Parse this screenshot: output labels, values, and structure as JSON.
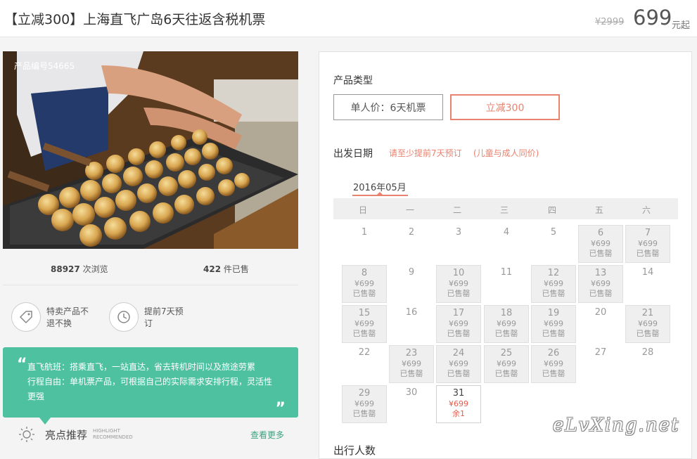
{
  "header": {
    "title": "【立减300】上海直飞广岛6天往返含税机票",
    "original_price": "¥2999",
    "price": "699",
    "price_suffix": "元起"
  },
  "product": {
    "id_label": "产品编号54665",
    "views_count": "88927",
    "views_label": "次浏览",
    "sold_count": "422",
    "sold_label": "件已售"
  },
  "features": [
    {
      "icon": "tag-icon",
      "text": "特卖产品不退不换"
    },
    {
      "icon": "clock-icon",
      "text": "提前7天预订"
    }
  ],
  "highlights": {
    "lines": [
      "直飞航班：搭乘直飞，一站直达，省去转机时间以及旅途劳累",
      "行程自由：单机票产品，可根据自己的实际需求安排行程，灵活性更强"
    ],
    "title": "亮点推荐",
    "title_en_1": "HIGHLIGHT",
    "title_en_2": "RECOMMENDED",
    "more": "查看更多"
  },
  "booking": {
    "type_label": "产品类型",
    "types": [
      "单人价：6天机票",
      "立减300"
    ],
    "selected_type": "立减300",
    "date_label": "出发日期",
    "note1": "请至少提前7天预订",
    "note2": "(儿童与成人同价)",
    "month": "2016年05月",
    "weekdays": [
      "日",
      "一",
      "二",
      "三",
      "四",
      "五",
      "六"
    ],
    "travelers_label": "出行人数"
  },
  "calendar": {
    "start_weekday": 0,
    "days": [
      {
        "d": "1",
        "state": "none"
      },
      {
        "d": "2",
        "state": "none"
      },
      {
        "d": "3",
        "state": "none"
      },
      {
        "d": "4",
        "state": "none"
      },
      {
        "d": "5",
        "state": "none"
      },
      {
        "d": "6",
        "state": "sold",
        "price": "¥699",
        "status": "已售罄"
      },
      {
        "d": "7",
        "state": "sold",
        "price": "¥699",
        "status": "已售罄"
      },
      {
        "d": "8",
        "state": "sold",
        "price": "¥699",
        "status": "已售罄"
      },
      {
        "d": "9",
        "state": "none"
      },
      {
        "d": "10",
        "state": "sold",
        "price": "¥699",
        "status": "已售罄"
      },
      {
        "d": "11",
        "state": "none"
      },
      {
        "d": "12",
        "state": "sold",
        "price": "¥699",
        "status": "已售罄"
      },
      {
        "d": "13",
        "state": "sold",
        "price": "¥699",
        "status": "已售罄"
      },
      {
        "d": "14",
        "state": "none"
      },
      {
        "d": "15",
        "state": "sold",
        "price": "¥699",
        "status": "已售罄"
      },
      {
        "d": "16",
        "state": "none"
      },
      {
        "d": "17",
        "state": "sold",
        "price": "¥699",
        "status": "已售罄"
      },
      {
        "d": "18",
        "state": "sold",
        "price": "¥699",
        "status": "已售罄"
      },
      {
        "d": "19",
        "state": "sold",
        "price": "¥699",
        "status": "已售罄"
      },
      {
        "d": "20",
        "state": "none"
      },
      {
        "d": "21",
        "state": "sold",
        "price": "¥699",
        "status": "已售罄"
      },
      {
        "d": "22",
        "state": "none"
      },
      {
        "d": "23",
        "state": "sold",
        "price": "¥699",
        "status": "已售罄"
      },
      {
        "d": "24",
        "state": "sold",
        "price": "¥699",
        "status": "已售罄"
      },
      {
        "d": "25",
        "state": "sold",
        "price": "¥699",
        "status": "已售罄"
      },
      {
        "d": "26",
        "state": "sold",
        "price": "¥699",
        "status": "已售罄"
      },
      {
        "d": "27",
        "state": "none"
      },
      {
        "d": "28",
        "state": "none"
      },
      {
        "d": "29",
        "state": "sold",
        "price": "¥699",
        "status": "已售罄"
      },
      {
        "d": "30",
        "state": "none"
      },
      {
        "d": "31",
        "state": "avail",
        "price": "¥699",
        "status": "余1"
      }
    ]
  },
  "watermark": "eLvXing.net",
  "colors": {
    "accent": "#e8836f",
    "green": "#4ec2a0",
    "price_red": "#e35b4b"
  }
}
